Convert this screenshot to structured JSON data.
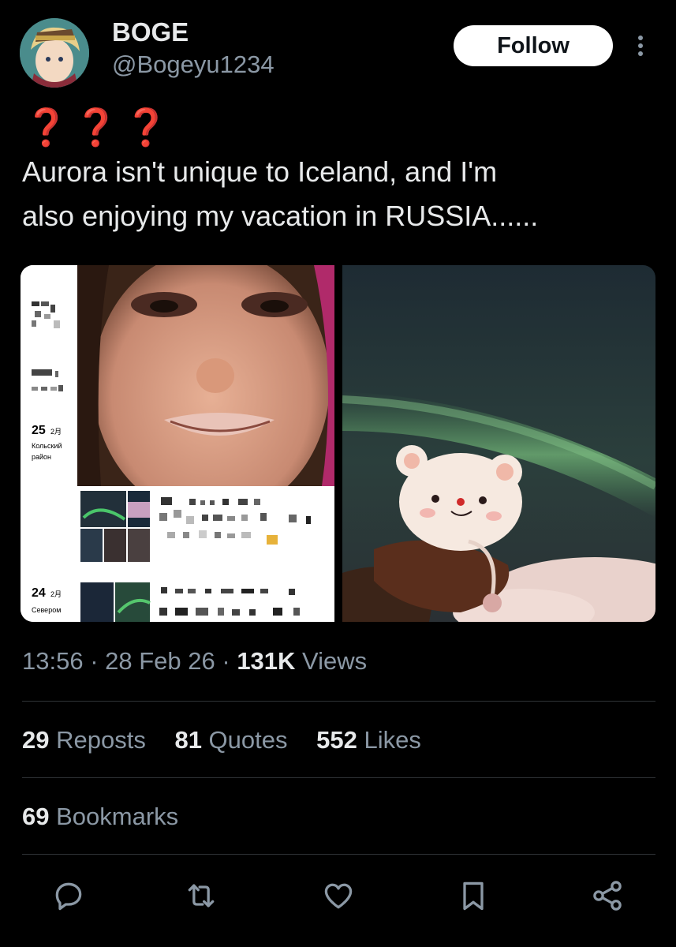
{
  "header": {
    "display_name": "BOGE",
    "handle": "@Bogeyu1234",
    "follow_label": "Follow"
  },
  "tweet": {
    "qmarks": "❓❓❓",
    "text_line1": "Aurora isn't unique to Iceland, and I'm",
    "text_line2": "also enjoying my vacation in RUSSIA......"
  },
  "media": {
    "left_dates": [
      {
        "day": "25",
        "unit": "2月",
        "place": "Кольский район"
      },
      {
        "day": "24",
        "unit": "2月",
        "place": "Севером"
      }
    ]
  },
  "meta": {
    "time": "13:56",
    "sep1": " · ",
    "date": "28 Feb 26",
    "sep2": " · ",
    "views_count": "131K",
    "views_label": " Views"
  },
  "stats": {
    "reposts_count": "29",
    "reposts_label": " Reposts",
    "quotes_count": "81",
    "quotes_label": " Quotes",
    "likes_count": "552",
    "likes_label": " Likes",
    "bookmarks_count": "69",
    "bookmarks_label": " Bookmarks"
  },
  "icons": [
    "reply-icon",
    "repost-icon",
    "like-icon",
    "bookmark-icon",
    "share-icon"
  ],
  "colors": {
    "background": "#000000",
    "text": "#e7e9ea",
    "muted": "#8b98a5",
    "follow_bg": "#ffffff",
    "qmark": "#e0202c"
  }
}
